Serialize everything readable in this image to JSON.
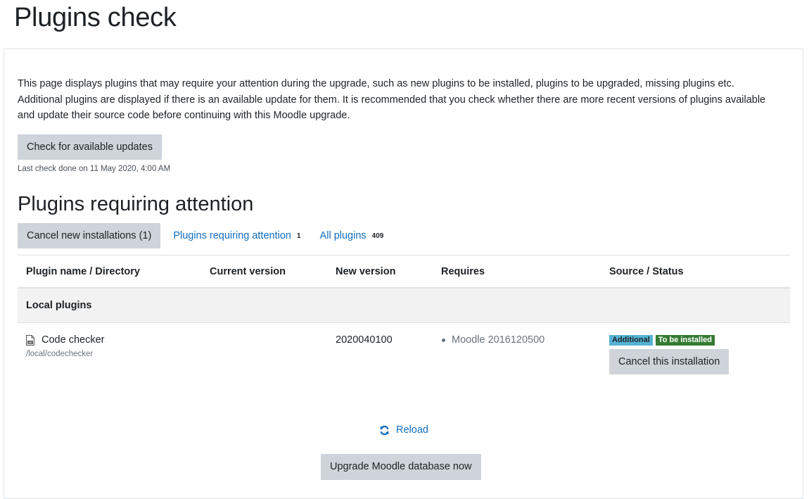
{
  "page": {
    "title": "Plugins check",
    "intro": "This page displays plugins that may require your attention during the upgrade, such as new plugins to be installed, plugins to be upgraded, missing plugins etc. Additional plugins are displayed if there is an available update for them. It is recommended that you check whether there are more recent versions of plugins available and update their source code before continuing with this Moodle upgrade.",
    "check_updates_label": "Check for available updates",
    "last_check": "Last check done on 11 May 2020, 4:00 AM",
    "section_title": "Plugins requiring attention"
  },
  "filters": {
    "cancel_new_label": "Cancel new installations (1)",
    "requiring_attention_label": "Plugins requiring attention",
    "requiring_attention_count": "1",
    "all_plugins_label": "All plugins",
    "all_plugins_count": "409"
  },
  "table": {
    "headers": {
      "name": "Plugin name / Directory",
      "current": "Current version",
      "new": "New version",
      "requires": "Requires",
      "source": "Source / Status"
    },
    "group": "Local plugins",
    "plugin": {
      "icon": "file-icon",
      "name": "Code checker",
      "directory": "/local/codechecker",
      "current_version": "",
      "new_version": "2020040100",
      "requires": "Moodle 2016120500",
      "source_badge": "Additional",
      "status_badge": "To be installed",
      "cancel_label": "Cancel this installation"
    }
  },
  "footer": {
    "reload_label": "Reload",
    "reload_icon": "refresh-icon",
    "upgrade_label": "Upgrade Moodle database now"
  },
  "colors": {
    "link": "#0f6cbf",
    "button_bg": "#ced4da",
    "badge_info": "#56b3d4",
    "badge_success": "#357a32"
  }
}
